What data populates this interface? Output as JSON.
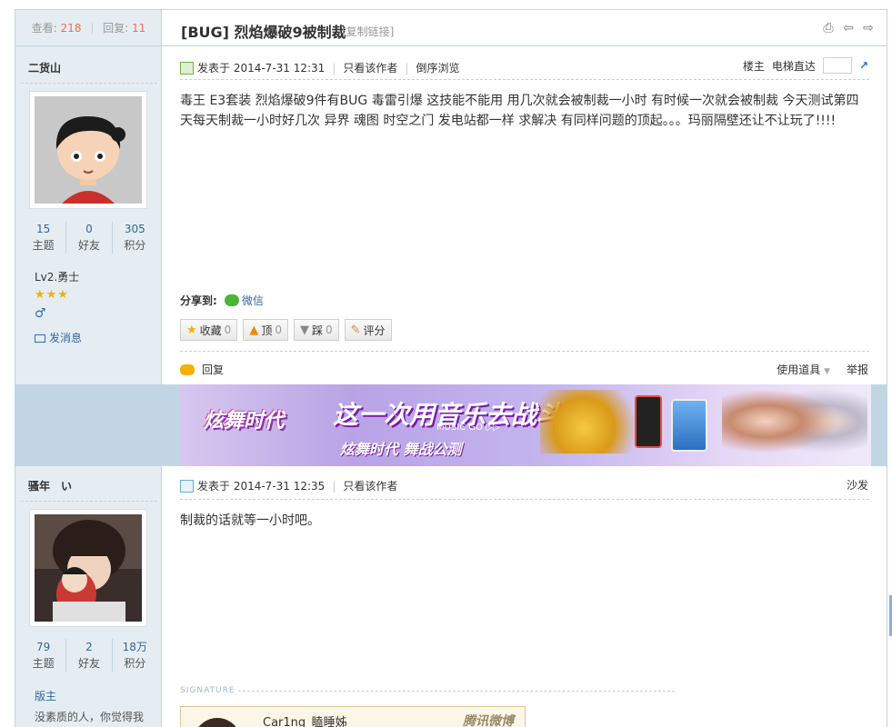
{
  "thread": {
    "views_label": "查看:",
    "views": "218",
    "replies_label": "回复:",
    "replies": "11",
    "title": "[BUG] 烈焰爆破9被制裁",
    "copy_link": "[复制链接]"
  },
  "posts": [
    {
      "author": "二货山",
      "stats": [
        {
          "num": "15",
          "label": "主题"
        },
        {
          "num": "0",
          "label": "好友"
        },
        {
          "num": "305",
          "label": "积分"
        }
      ],
      "level": "Lv2.勇士",
      "stars": "★★★",
      "gender_icon": "♂",
      "send_message": "发消息",
      "posted_at": "发表于 2014-7-31 12:31",
      "only_author": "只看该作者",
      "reverse": "倒序浏览",
      "floor": "楼主",
      "jump_label": "电梯直达",
      "body": "毒王 E3套装 烈焰爆破9件有BUG 毒雷引爆 这技能不能用 用几次就会被制裁一小时 有时候一次就会被制裁 今天测试第四天每天制裁一小时好几次 异界 魂图 时空之门 发电站都一样 求解决 有同样问题的顶起。。。玛丽隔壁还让不让玩了!!!!",
      "share_label": "分享到:",
      "share_wechat": "微信",
      "actions": [
        {
          "label": "收藏",
          "count": "0",
          "icon": "star-icon",
          "glyph": "★"
        },
        {
          "label": "顶",
          "count": "0",
          "icon": "thumb-up-icon",
          "glyph": "▲"
        },
        {
          "label": "踩",
          "count": "0",
          "icon": "thumb-down-icon",
          "glyph": "▼"
        },
        {
          "label": "评分",
          "count": "",
          "icon": "rate-icon",
          "glyph": "✎"
        }
      ],
      "reply": "回复",
      "use_tools": "使用道具",
      "report": "举报"
    },
    {
      "author": "骚年　い",
      "stats": [
        {
          "num": "79",
          "label": "主题"
        },
        {
          "num": "2",
          "label": "好友"
        },
        {
          "num": "18万",
          "label": "积分"
        }
      ],
      "role": "版主",
      "bio": "没素质的人，你觉得我",
      "posted_at": "发表于 2014-7-31 12:35",
      "only_author": "只看该作者",
      "floor": "沙发",
      "body": "制裁的话就等一小时吧。",
      "signature_label": "SIGNATURE",
      "weibo_name": "Car1ng_瞌睡姊",
      "weibo_brand": "腾讯微博"
    }
  ],
  "ad": {
    "logo": "炫舞时代",
    "headline": "这一次用音乐去战斗",
    "music_go": "MUSIC GO ▷▷",
    "sub": "炫舞时代 舞战公测"
  }
}
